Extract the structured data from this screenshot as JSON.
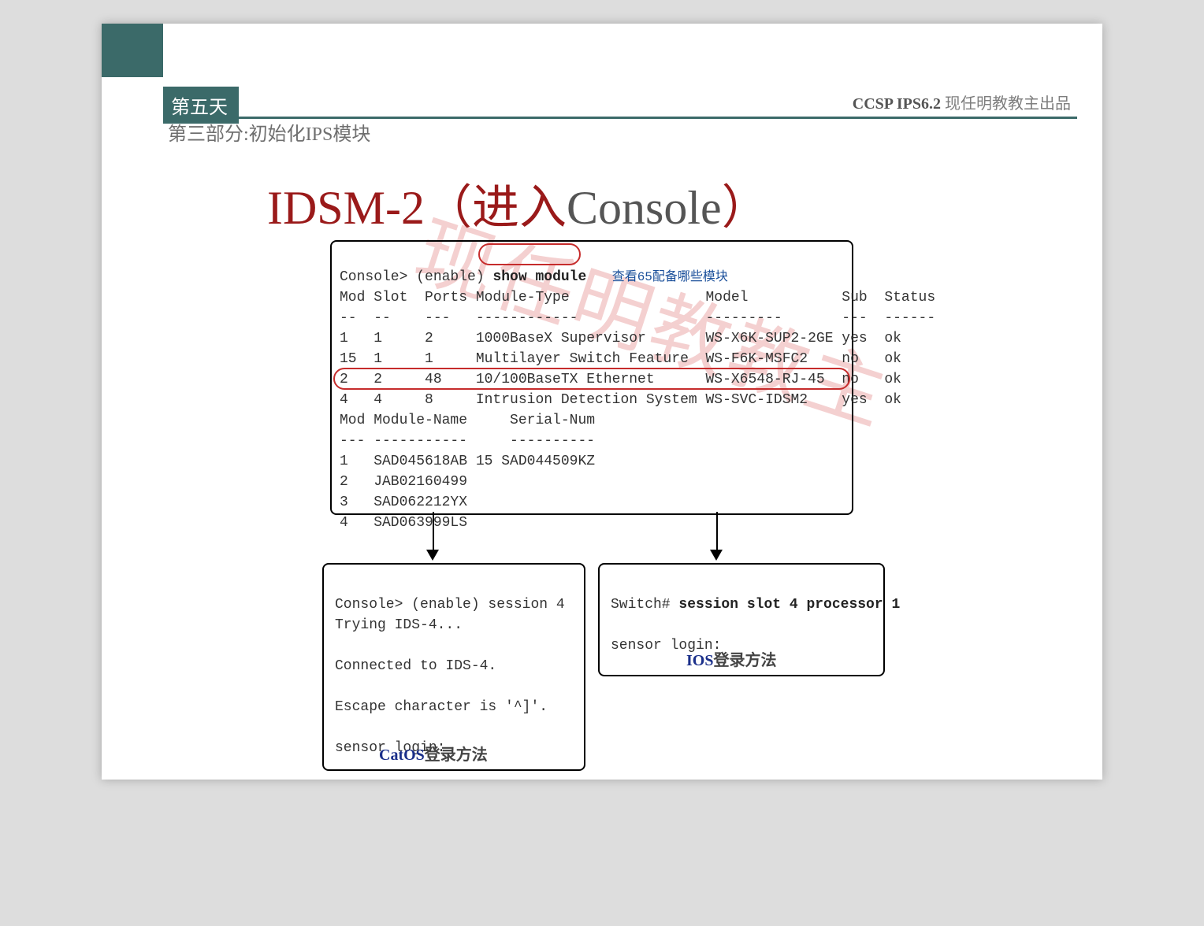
{
  "header": {
    "right_course_bold": "CCSP IPS6.2",
    "right_course_tail": "  现任明教教主出品",
    "day": "第五天",
    "section": "第三部分:初始化IPS模块"
  },
  "title": {
    "main": "IDSM-2",
    "paren_open": "（",
    "zhcn": "进入",
    "tail": "Console",
    "paren_close": "）"
  },
  "watermark": "现任明教教主",
  "topbox": {
    "prompt": "Console> (enable)",
    "cmd": "show module",
    "cmd_note": "查看65配备哪些模块",
    "hdr_line": "Mod Slot  Ports Module-Type                Model           Sub  Status",
    "sep_line": "--  --    ---   ------------               ---------       ---  ------",
    "rows": [
      "1   1     2     1000BaseX Supervisor       WS-X6K-SUP2-2GE yes  ok",
      "15  1     1     Multilayer Switch Feature  WS-F6K-MSFC2    no   ok",
      "2   2     48    10/100BaseTX Ethernet      WS-X6548-RJ-45  no   ok",
      "4   4     8     Intrusion Detection System WS-SVC-IDSM2    yes  ok"
    ],
    "hdr2": "Mod Module-Name     Serial-Num",
    "sep2": "--- -----------     ----------",
    "rows2": [
      "1   SAD045618AB 15 SAD044509KZ",
      "2   JAB02160499",
      "3   SAD062212YX",
      "4   SAD063999LS"
    ]
  },
  "leftbox": {
    "l1": "Console> (enable) session 4",
    "l2": "Trying IDS-4...",
    "l3": "",
    "l4": "Connected to IDS-4.",
    "l5": "",
    "l6": "Escape character is '^]'.",
    "l7": "",
    "l8": "sensor login:",
    "cap_en": "CatOS",
    "cap_zh": "登录方法"
  },
  "rightbox": {
    "l1_pre": "Switch# ",
    "l1_cmd": "session slot 4 processor 1",
    "l2": "",
    "l3": "sensor login:",
    "cap_en": "IOS",
    "cap_zh": "登录方法"
  }
}
